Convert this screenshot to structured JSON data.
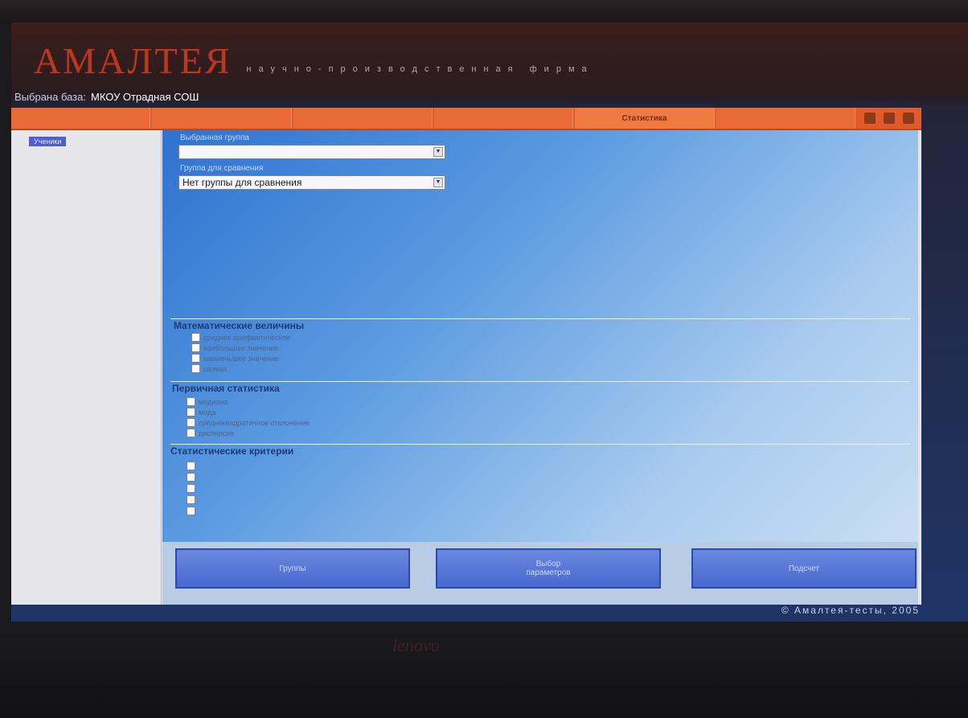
{
  "branding": {
    "logo": "АМАЛТЕЯ",
    "subtitle": "научно-производственная фирма",
    "device_logo": "lenovo",
    "copyright": "© Амалтея-тесты, 2005"
  },
  "database_bar": {
    "label": "Выбрана база:",
    "value": "МКОУ Отрадная СОШ"
  },
  "tabs": [
    {
      "label": ""
    },
    {
      "label": ""
    },
    {
      "label": ""
    },
    {
      "label": ""
    },
    {
      "label": "Статистика",
      "active": true
    },
    {
      "label": ""
    }
  ],
  "sidebar": {
    "selected_item": "Ученики"
  },
  "form": {
    "group_label": "Выбранная группа",
    "group_value": "",
    "compare_label": "Группа для сравнения",
    "compare_value": "Нет группы для сравнения"
  },
  "sections": {
    "math": {
      "title": "Математические величины",
      "items": [
        "среднее арифметическое",
        "наибольшее значение",
        "наименьшее значение",
        "размах"
      ]
    },
    "primary": {
      "title": "Первичная статистика",
      "items": [
        "медиана",
        "мода",
        "среднеквадратичное отклонение",
        "дисперсия"
      ]
    },
    "criteria": {
      "title": "Статистические критерии",
      "items": [
        "",
        "",
        "",
        "",
        ""
      ]
    }
  },
  "buttons": {
    "groups": "Группы",
    "choose_line1": "Выбор",
    "choose_line2": "параметров",
    "calculate": "Подсчет"
  },
  "colors": {
    "brand": "#b53a24",
    "tab_bar": "#e15b2a",
    "accent_blue": "#4869cf"
  }
}
